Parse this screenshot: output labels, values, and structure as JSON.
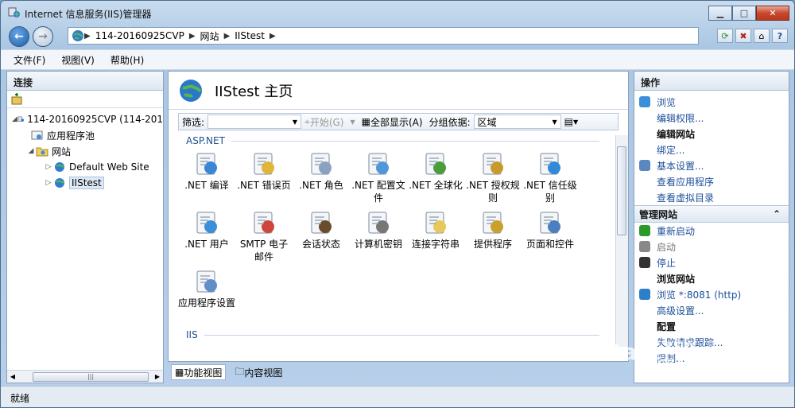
{
  "window": {
    "title": "Internet 信息服务(IIS)管理器"
  },
  "address": {
    "crumbs": [
      "114-20160925CVP",
      "网站",
      "IIStest"
    ]
  },
  "menu": [
    "文件(F)",
    "视图(V)",
    "帮助(H)"
  ],
  "connections": {
    "title": "连接",
    "tree": [
      {
        "label": "114-20160925CVP (114-201",
        "level": 0
      },
      {
        "label": "应用程序池",
        "level": 1
      },
      {
        "label": "网站",
        "level": 1
      },
      {
        "label": "Default Web Site",
        "level": 2
      },
      {
        "label": "IIStest",
        "level": 2
      }
    ]
  },
  "home": {
    "title": "IIStest 主页"
  },
  "filter": {
    "label": "筛选:",
    "start": "开始(G)",
    "show_all": "全部显示(A)",
    "group_by": "分组依据:",
    "group_value": "区域"
  },
  "groups": [
    {
      "name": "ASP.NET",
      "features": [
        ".NET 编译",
        ".NET 错误页",
        ".NET 角色",
        ".NET 配置文件",
        ".NET 全球化",
        ".NET 授权规则",
        ".NET 信任级别",
        ".NET 用户",
        "SMTP 电子邮件",
        "会话状态",
        "计算机密钥",
        "连接字符串",
        "提供程序",
        "页面和控件",
        "应用程序设置"
      ]
    },
    {
      "name": "IIS",
      "features": []
    }
  ],
  "view_tabs": {
    "features": "功能视图",
    "content": "内容视图"
  },
  "actions": {
    "title": "操作",
    "items": [
      {
        "label": "浏览",
        "type": "link"
      },
      {
        "label": "编辑权限...",
        "type": "link"
      },
      {
        "label": "编辑网站",
        "type": "sec"
      },
      {
        "label": "绑定...",
        "type": "link"
      },
      {
        "label": "基本设置...",
        "type": "link"
      },
      {
        "label": "查看应用程序",
        "type": "link"
      },
      {
        "label": "查看虚拟目录",
        "type": "link"
      },
      {
        "label": "管理网站",
        "type": "head"
      },
      {
        "label": "重新启动",
        "type": "link"
      },
      {
        "label": "启动",
        "type": "dis"
      },
      {
        "label": "停止",
        "type": "link"
      },
      {
        "label": "浏览网站",
        "type": "sec"
      },
      {
        "label": "浏览 *:8081 (http)",
        "type": "link"
      },
      {
        "label": "高级设置...",
        "type": "link"
      },
      {
        "label": "配置",
        "type": "sec"
      },
      {
        "label": "失败请求跟踪...",
        "type": "link"
      },
      {
        "label": "限制...",
        "type": "link"
      }
    ]
  },
  "status": {
    "text": "就绪"
  },
  "watermark": "Bai 经验"
}
